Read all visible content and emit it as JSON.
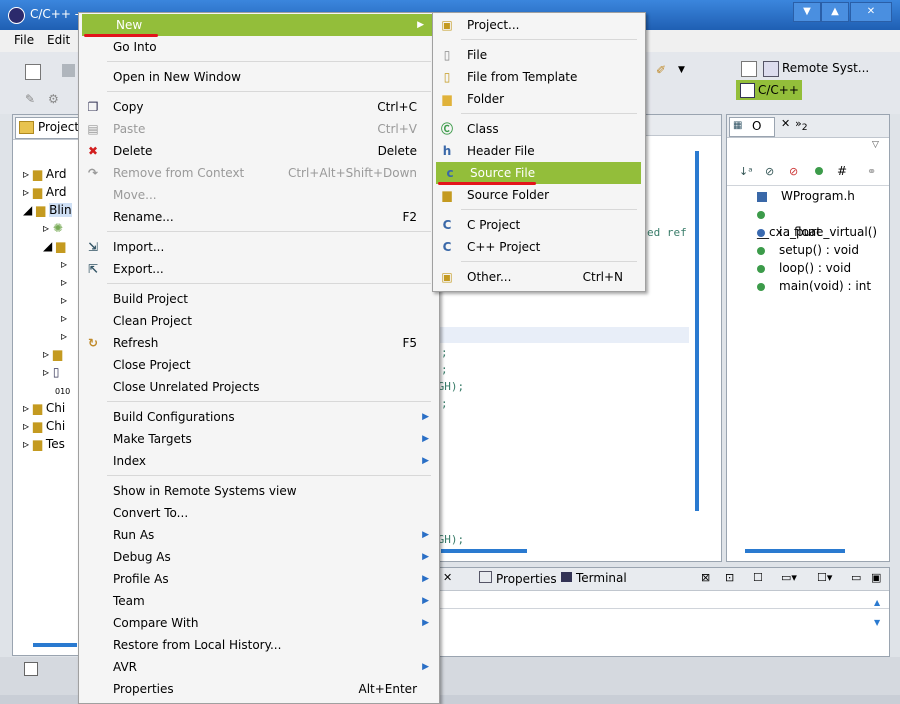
{
  "window": {
    "title": "C/C++ - "
  },
  "menubar": {
    "items": [
      "File",
      "Edit"
    ]
  },
  "perspective": {
    "remote_label": "Remote Syst...",
    "cpp_label": "C/C++"
  },
  "project_explorer": {
    "tab_label": "Project",
    "items": [
      {
        "label": "Ard"
      },
      {
        "label": "Ard"
      },
      {
        "label": "Blin"
      },
      {
        "label": "Chi"
      },
      {
        "label": "Chi"
      },
      {
        "label": "Tes"
      }
    ]
  },
  "editor": {
    "lines": [
      "ed ref",
      ";",
      ";",
      "IGH);",
      ";",
      "IGH);"
    ]
  },
  "outline": {
    "tab_label": "O",
    "tab2_label": "2",
    "items": [
      {
        "label": "WProgram.h",
        "icon": "header-icon"
      },
      {
        "label": "__cxa_pure_virtual()",
        "icon": "function-icon"
      },
      {
        "label": "i : float",
        "icon": "variable-icon"
      },
      {
        "label": "setup() : void",
        "icon": "function-icon"
      },
      {
        "label": "loop() : void",
        "icon": "function-icon"
      },
      {
        "label": "main(void) : int",
        "icon": "function-icon"
      }
    ]
  },
  "bottom_panel": {
    "properties_label": "Properties",
    "terminal_label": "Terminal"
  },
  "context_menu": {
    "items": [
      {
        "label": "New",
        "submenu": true,
        "highlighted": true
      },
      {
        "label": "Go Into"
      },
      {
        "sep": true
      },
      {
        "label": "Open in New Window"
      },
      {
        "sep": true
      },
      {
        "label": "Copy",
        "shortcut": "Ctrl+C",
        "icon": "copy-icon"
      },
      {
        "label": "Paste",
        "shortcut": "Ctrl+V",
        "disabled": true,
        "icon": "paste-icon"
      },
      {
        "label": "Delete",
        "shortcut": "Delete",
        "icon": "delete-icon"
      },
      {
        "label": "Remove from Context",
        "shortcut": "Ctrl+Alt+Shift+Down",
        "disabled": true,
        "icon": "remove-icon"
      },
      {
        "label": "Move...",
        "disabled": true
      },
      {
        "label": "Rename...",
        "shortcut": "F2"
      },
      {
        "sep": true
      },
      {
        "label": "Import...",
        "icon": "import-icon"
      },
      {
        "label": "Export...",
        "icon": "export-icon"
      },
      {
        "sep": true
      },
      {
        "label": "Build Project"
      },
      {
        "label": "Clean Project"
      },
      {
        "label": "Refresh",
        "shortcut": "F5",
        "icon": "refresh-icon"
      },
      {
        "label": "Close Project"
      },
      {
        "label": "Close Unrelated Projects"
      },
      {
        "sep": true
      },
      {
        "label": "Build Configurations",
        "submenu": true
      },
      {
        "label": "Make Targets",
        "submenu": true
      },
      {
        "label": "Index",
        "submenu": true
      },
      {
        "sep": true
      },
      {
        "label": "Show in Remote Systems view"
      },
      {
        "label": "Convert To..."
      },
      {
        "label": "Run As",
        "submenu": true
      },
      {
        "label": "Debug As",
        "submenu": true
      },
      {
        "label": "Profile As",
        "submenu": true
      },
      {
        "label": "Team",
        "submenu": true
      },
      {
        "label": "Compare With",
        "submenu": true
      },
      {
        "label": "Restore from Local History..."
      },
      {
        "label": "AVR",
        "submenu": true
      },
      {
        "label": "Properties",
        "shortcut": "Alt+Enter"
      }
    ]
  },
  "new_submenu": {
    "items": [
      {
        "label": "Project...",
        "icon": "project-icon"
      },
      {
        "sep": true
      },
      {
        "label": "File",
        "icon": "file-icon"
      },
      {
        "label": "File from Template",
        "icon": "file-template-icon"
      },
      {
        "label": "Folder",
        "icon": "folder-icon"
      },
      {
        "sep": true
      },
      {
        "label": "Class",
        "icon": "class-icon"
      },
      {
        "label": "Header File",
        "icon": "header-file-icon"
      },
      {
        "label": "Source File",
        "icon": "source-file-icon",
        "highlighted": true
      },
      {
        "label": "Source Folder",
        "icon": "source-folder-icon"
      },
      {
        "sep": true
      },
      {
        "label": "C Project",
        "icon": "c-project-icon"
      },
      {
        "label": "C++ Project",
        "icon": "cpp-project-icon"
      },
      {
        "sep": true
      },
      {
        "label": "Other...",
        "shortcut": "Ctrl+N",
        "icon": "other-icon"
      }
    ]
  },
  "colors": {
    "highlight": "#93be3a",
    "title_bar": "#2b6fc6",
    "annotation": "#e3141b"
  }
}
